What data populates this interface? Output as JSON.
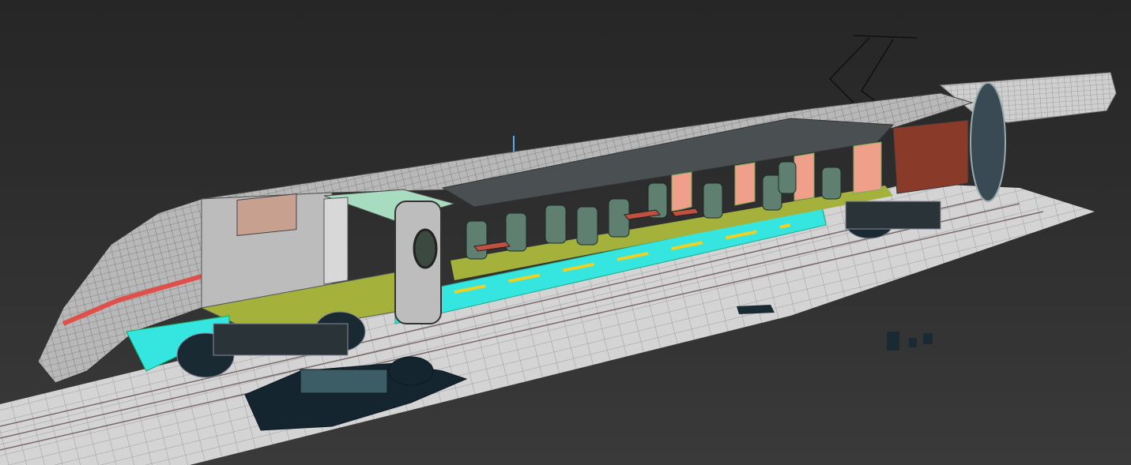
{
  "scene": {
    "subject": "train-cutaway-model",
    "colors": {
      "background": "#2b2b2b",
      "track": "#d6d6d6",
      "body": "#b9b9b9",
      "floor": "#a4b23c",
      "cyan": "#35e6e0",
      "interior_wall": "#f0a08a",
      "rear_wall": "#8a3a28",
      "stripe": "#e0504a",
      "seat": "#5f7f70",
      "bogie": "#1a2a33"
    }
  }
}
